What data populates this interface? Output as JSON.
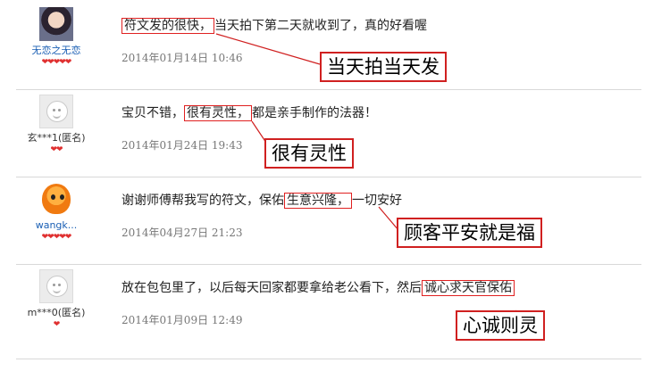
{
  "reviews": [
    {
      "username": "无恋之无恋",
      "hearts": "❤❤❤❤❤",
      "text_before": "",
      "highlight": "符文发的很快，",
      "text_after": "当天拍下第二天就收到了，真的好看喔",
      "date": "2014年01月14日  10:46",
      "callout": "当天拍当天发"
    },
    {
      "username": "玄***1(匿名)",
      "hearts": "❤❤",
      "text_before": "宝贝不错，",
      "highlight": "很有灵性，",
      "text_after": "都是亲手制作的法器！",
      "date": "2014年01月24日  19:43",
      "callout": "很有灵性"
    },
    {
      "username": "wangk...",
      "hearts": "❤❤❤❤❤",
      "text_before": "谢谢师傅帮我写的符文，保佑",
      "highlight": "生意兴隆，",
      "text_after": "一切安好",
      "date": "2014年04月27日  21:23",
      "callout": "顾客平安就是福"
    },
    {
      "username": "m***0(匿名)",
      "hearts": "❤",
      "text_before": "放在包包里了，以后每天回家都要拿给老公看下，然后",
      "highlight": "诚心求天官保佑",
      "text_after": "",
      "date": "2014年01月09日  12:49",
      "callout": "心诚则灵"
    }
  ]
}
